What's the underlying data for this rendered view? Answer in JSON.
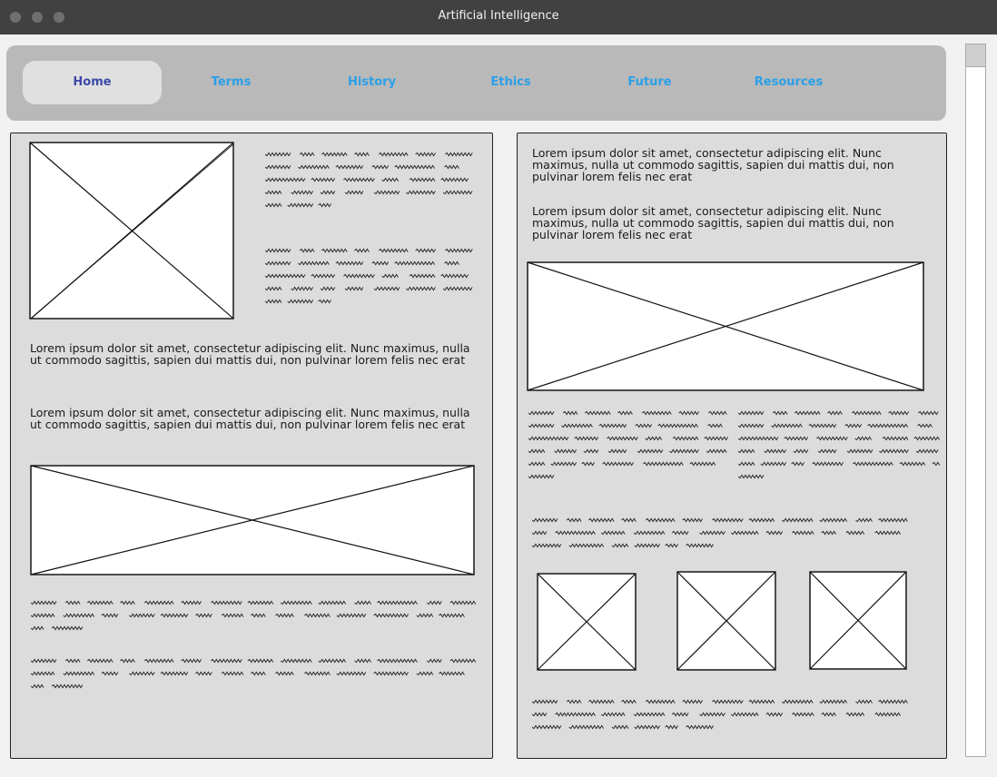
{
  "window": {
    "title": "Artificial Intelligence"
  },
  "nav": {
    "items": [
      {
        "label": "Home",
        "active": true
      },
      {
        "label": "Terms"
      },
      {
        "label": "History"
      },
      {
        "label": "Ethics"
      },
      {
        "label": "Future"
      },
      {
        "label": "Resources"
      }
    ]
  },
  "left": {
    "para1": "Lorem ipsum dolor sit amet, consectetur adipiscing elit. Nunc maximus, nulla ut commodo sagittis, sapien dui mattis dui, non pulvinar lorem felis nec erat",
    "para2": "Lorem ipsum dolor sit amet, consectetur adipiscing elit. Nunc maximus, nulla ut commodo sagittis, sapien dui mattis dui, non pulvinar lorem felis nec erat"
  },
  "right": {
    "para1": "Lorem ipsum dolor sit amet, consectetur adipiscing elit. Nunc maximus, nulla ut commodo sagittis, sapien dui mattis dui, non pulvinar lorem felis nec erat",
    "para2": "Lorem ipsum dolor sit amet, consectetur adipiscing elit. Nunc maximus, nulla ut commodo sagittis, sapien dui mattis dui, non pulvinar lorem felis nec erat"
  },
  "colors": {
    "titlebar": "#404140",
    "nav_bg": "#b9b9b9",
    "nav_link": "#2aa0e8",
    "nav_active_text": "#3d49a6",
    "panel_bg": "#dcdcdc"
  },
  "icons": {
    "window_controls": [
      "close-dot",
      "minimize-dot",
      "maximize-dot"
    ],
    "image_placeholder": "crossed-box-icon",
    "text_placeholder": "scribble-lines"
  }
}
